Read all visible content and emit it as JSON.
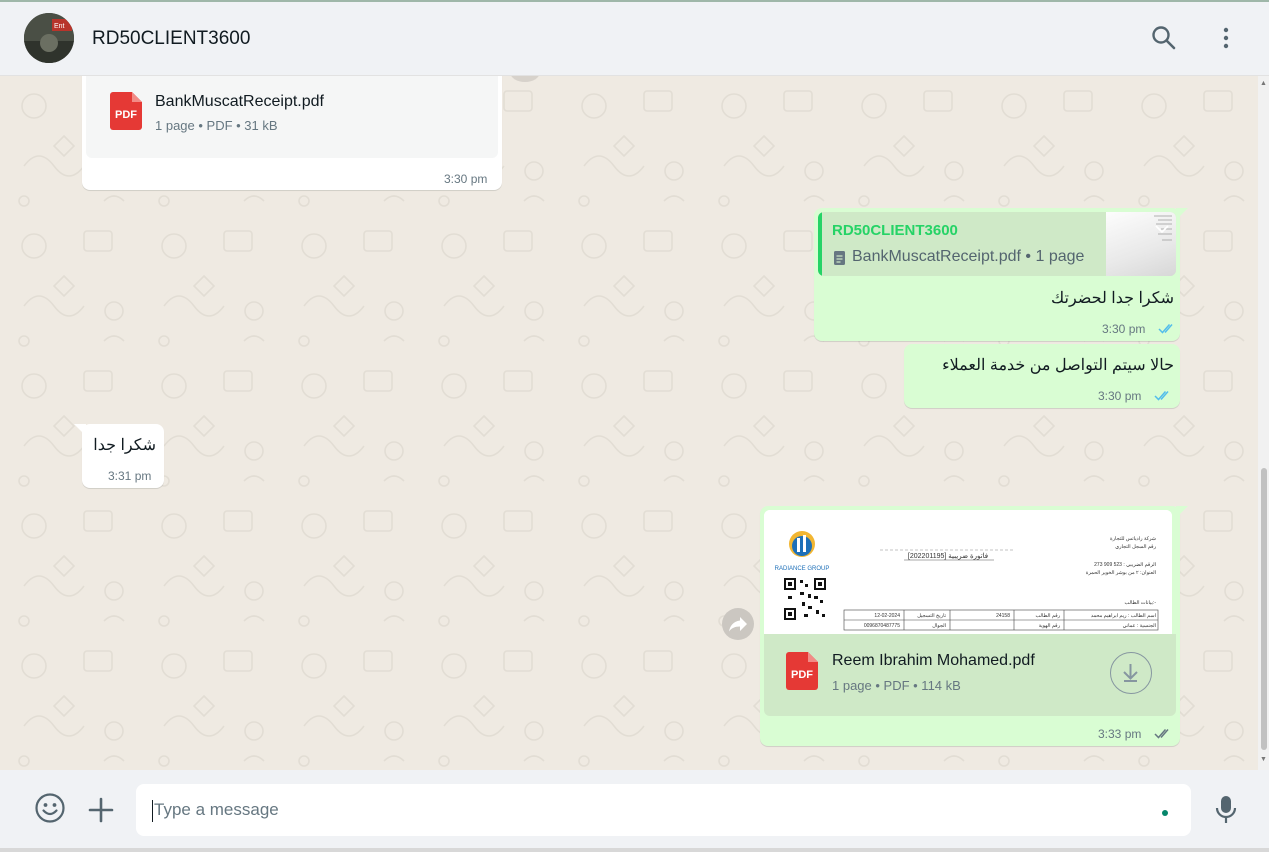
{
  "header": {
    "contact_name": "RD50CLIENT3600",
    "avatar_label": "Ent"
  },
  "messages": {
    "m1": {
      "file_name": "BankMuscatReceipt.pdf",
      "file_meta": "1 page • PDF • 31 kB",
      "time": "3:30 pm",
      "icon_label": "PDF"
    },
    "m2": {
      "quote_author": "RD50CLIENT3600",
      "quote_text": "BankMuscatReceipt.pdf • 1 page",
      "text": "شكرا جدا لحضرتك",
      "time": "3:30 pm"
    },
    "m3": {
      "text": "حالا سيتم التواصل من خدمة العملاء",
      "time": "3:30 pm"
    },
    "m4": {
      "text": "شكرا جدا",
      "time": "3:31 pm"
    },
    "m5": {
      "file_name": "Reem Ibrahim Mohamed.pdf",
      "file_meta": "1 page • PDF • 114 kB",
      "time": "3:33 pm",
      "icon_label": "PDF",
      "preview": {
        "logo_text": "RADIANCE GROUP",
        "title_line": "فاتورة ضريبية [202201195]",
        "company_line1": "شركة رادياتس للتجارة",
        "company_line2": "رقم السجل التجاري",
        "company_line3": "الرقم الضريبي : 523 909 273",
        "company_line4": "العنوان: ٢ من بوشر الخوير الحمرة",
        "section_label": "بيانات الطالب:-",
        "row1": [
          "اسم الطالب : ريم ابراهيم محمد",
          "رقم الطالب",
          "24158",
          "تاريخ التسجيل",
          "12-02-2024"
        ],
        "row2": [
          "الجنسية : عماني",
          "رقم الهوية",
          "",
          "الجوال",
          "0096870487775"
        ]
      }
    }
  },
  "composer": {
    "placeholder": "Type a message"
  },
  "colors": {
    "outgoing_bubble": "#d9fdd3",
    "incoming_bubble": "#ffffff",
    "chat_background": "#efeae2",
    "read_ticks": "#53bdeb",
    "accent_green": "#25d366",
    "pdf_red": "#e53935"
  },
  "icons": {
    "search": "search-icon",
    "menu": "kebab-menu-icon",
    "emoji": "emoji-icon",
    "attach": "plus-icon",
    "mic": "microphone-icon",
    "download": "download-icon",
    "forward": "forward-icon",
    "read_receipt": "double-check-icon",
    "delivered_receipt": "double-check-icon"
  }
}
